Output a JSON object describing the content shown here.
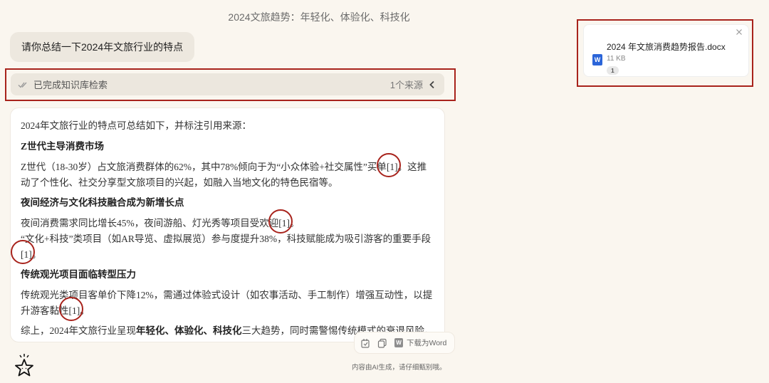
{
  "header": {
    "title": "2024文旅趋势：年轻化、体验化、科技化"
  },
  "user_message": "请你总结一下2024年文旅行业的特点",
  "search_status": {
    "label": "已完成知识库检索",
    "source_count": "1个来源"
  },
  "answer": {
    "intro": "2024年文旅行业的特点可总结如下，并标注引用来源：",
    "sections": [
      {
        "heading": "Z世代主导消费市场",
        "text_a": "Z世代（18-30岁）占文旅消费群体的62%，其中78%倾向于为“小众体验+社交属性”买单",
        "cite": "[1]",
        "text_b": "。这推动了个性化、社交分享型文旅项目的兴起，如融入当地文化的特色民宿等。"
      },
      {
        "heading": "夜间经济与文化科技融合成为新增长点",
        "line1_a": "夜间消费需求同比增长45%，夜间游船、灯光秀等项目受欢迎",
        "line1_cite": "[1]",
        "line1_b": "。",
        "line2_a": "“文化+科技”类项目（如AR导览、虚拟展览）参与度提升38%，科技赋能成为吸引游客的重要手段",
        "line2_cite": "[1]",
        "line2_b": "。"
      },
      {
        "heading": "传统观光项目面临转型压力",
        "text_a": "传统观光类项目客单价下降12%，需通过体验式设计（如农事活动、手工制作）增强互动性，以提升游客黏性",
        "cite": "[1]",
        "text_b": "。"
      }
    ],
    "summary_a": "综上，2024年文旅行业呈现",
    "summary_bold": "年轻化、体验化、科技化",
    "summary_b": "三大趋势，同时需警惕传统模式的衰退风险。"
  },
  "actions": {
    "download_word": "下载为Word"
  },
  "disclaimer": "内容由AI生成，请仔细甄别哦。",
  "file": {
    "name": "2024 年文旅消费趋势报告.docx",
    "size": "11 KB",
    "badge": "1",
    "icon_letter": "W"
  },
  "colors": {
    "highlight": "#a8231c",
    "background": "#faf6ef",
    "word_blue": "#2b65d9"
  }
}
